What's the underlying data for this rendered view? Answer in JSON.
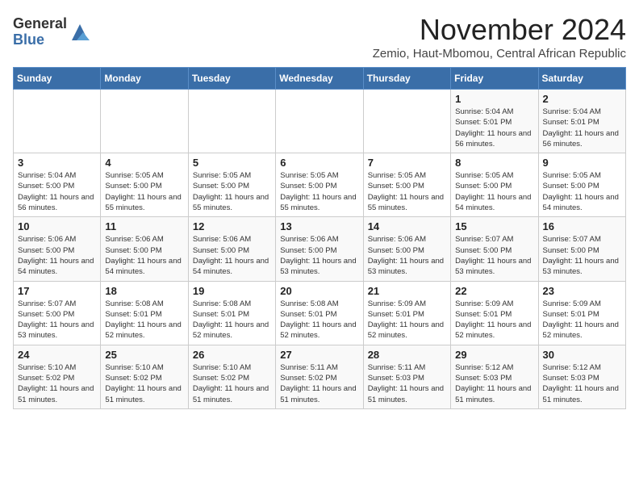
{
  "header": {
    "logo_general": "General",
    "logo_blue": "Blue",
    "month_title": "November 2024",
    "subtitle": "Zemio, Haut-Mbomou, Central African Republic"
  },
  "weekdays": [
    "Sunday",
    "Monday",
    "Tuesday",
    "Wednesday",
    "Thursday",
    "Friday",
    "Saturday"
  ],
  "weeks": [
    [
      {
        "day": "",
        "info": ""
      },
      {
        "day": "",
        "info": ""
      },
      {
        "day": "",
        "info": ""
      },
      {
        "day": "",
        "info": ""
      },
      {
        "day": "",
        "info": ""
      },
      {
        "day": "1",
        "info": "Sunrise: 5:04 AM\nSunset: 5:01 PM\nDaylight: 11 hours and 56 minutes."
      },
      {
        "day": "2",
        "info": "Sunrise: 5:04 AM\nSunset: 5:01 PM\nDaylight: 11 hours and 56 minutes."
      }
    ],
    [
      {
        "day": "3",
        "info": "Sunrise: 5:04 AM\nSunset: 5:00 PM\nDaylight: 11 hours and 56 minutes."
      },
      {
        "day": "4",
        "info": "Sunrise: 5:05 AM\nSunset: 5:00 PM\nDaylight: 11 hours and 55 minutes."
      },
      {
        "day": "5",
        "info": "Sunrise: 5:05 AM\nSunset: 5:00 PM\nDaylight: 11 hours and 55 minutes."
      },
      {
        "day": "6",
        "info": "Sunrise: 5:05 AM\nSunset: 5:00 PM\nDaylight: 11 hours and 55 minutes."
      },
      {
        "day": "7",
        "info": "Sunrise: 5:05 AM\nSunset: 5:00 PM\nDaylight: 11 hours and 55 minutes."
      },
      {
        "day": "8",
        "info": "Sunrise: 5:05 AM\nSunset: 5:00 PM\nDaylight: 11 hours and 54 minutes."
      },
      {
        "day": "9",
        "info": "Sunrise: 5:05 AM\nSunset: 5:00 PM\nDaylight: 11 hours and 54 minutes."
      }
    ],
    [
      {
        "day": "10",
        "info": "Sunrise: 5:06 AM\nSunset: 5:00 PM\nDaylight: 11 hours and 54 minutes."
      },
      {
        "day": "11",
        "info": "Sunrise: 5:06 AM\nSunset: 5:00 PM\nDaylight: 11 hours and 54 minutes."
      },
      {
        "day": "12",
        "info": "Sunrise: 5:06 AM\nSunset: 5:00 PM\nDaylight: 11 hours and 54 minutes."
      },
      {
        "day": "13",
        "info": "Sunrise: 5:06 AM\nSunset: 5:00 PM\nDaylight: 11 hours and 53 minutes."
      },
      {
        "day": "14",
        "info": "Sunrise: 5:06 AM\nSunset: 5:00 PM\nDaylight: 11 hours and 53 minutes."
      },
      {
        "day": "15",
        "info": "Sunrise: 5:07 AM\nSunset: 5:00 PM\nDaylight: 11 hours and 53 minutes."
      },
      {
        "day": "16",
        "info": "Sunrise: 5:07 AM\nSunset: 5:00 PM\nDaylight: 11 hours and 53 minutes."
      }
    ],
    [
      {
        "day": "17",
        "info": "Sunrise: 5:07 AM\nSunset: 5:00 PM\nDaylight: 11 hours and 53 minutes."
      },
      {
        "day": "18",
        "info": "Sunrise: 5:08 AM\nSunset: 5:01 PM\nDaylight: 11 hours and 52 minutes."
      },
      {
        "day": "19",
        "info": "Sunrise: 5:08 AM\nSunset: 5:01 PM\nDaylight: 11 hours and 52 minutes."
      },
      {
        "day": "20",
        "info": "Sunrise: 5:08 AM\nSunset: 5:01 PM\nDaylight: 11 hours and 52 minutes."
      },
      {
        "day": "21",
        "info": "Sunrise: 5:09 AM\nSunset: 5:01 PM\nDaylight: 11 hours and 52 minutes."
      },
      {
        "day": "22",
        "info": "Sunrise: 5:09 AM\nSunset: 5:01 PM\nDaylight: 11 hours and 52 minutes."
      },
      {
        "day": "23",
        "info": "Sunrise: 5:09 AM\nSunset: 5:01 PM\nDaylight: 11 hours and 52 minutes."
      }
    ],
    [
      {
        "day": "24",
        "info": "Sunrise: 5:10 AM\nSunset: 5:02 PM\nDaylight: 11 hours and 51 minutes."
      },
      {
        "day": "25",
        "info": "Sunrise: 5:10 AM\nSunset: 5:02 PM\nDaylight: 11 hours and 51 minutes."
      },
      {
        "day": "26",
        "info": "Sunrise: 5:10 AM\nSunset: 5:02 PM\nDaylight: 11 hours and 51 minutes."
      },
      {
        "day": "27",
        "info": "Sunrise: 5:11 AM\nSunset: 5:02 PM\nDaylight: 11 hours and 51 minutes."
      },
      {
        "day": "28",
        "info": "Sunrise: 5:11 AM\nSunset: 5:03 PM\nDaylight: 11 hours and 51 minutes."
      },
      {
        "day": "29",
        "info": "Sunrise: 5:12 AM\nSunset: 5:03 PM\nDaylight: 11 hours and 51 minutes."
      },
      {
        "day": "30",
        "info": "Sunrise: 5:12 AM\nSunset: 5:03 PM\nDaylight: 11 hours and 51 minutes."
      }
    ]
  ]
}
